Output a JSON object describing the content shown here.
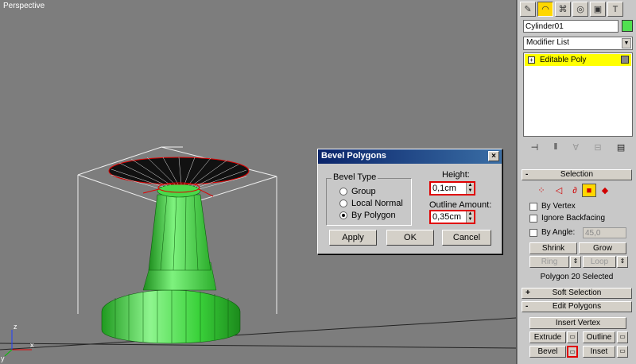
{
  "viewport": {
    "label": "Perspective"
  },
  "dialog": {
    "title": "Bevel Polygons",
    "close_glyph": "×",
    "bevel_type": {
      "legend": "Bevel Type",
      "options": [
        "Group",
        "Local Normal",
        "By Polygon"
      ],
      "selected": "By Polygon"
    },
    "height": {
      "label": "Height:",
      "value": "0,1cm"
    },
    "outline": {
      "label": "Outline Amount:",
      "value": "0,35cm"
    },
    "buttons": {
      "apply": "Apply",
      "ok": "OK",
      "cancel": "Cancel"
    }
  },
  "panel": {
    "tabs": [
      "create-tab",
      "modify-tab",
      "hierarchy-tab",
      "motion-tab",
      "display-tab",
      "utilities-tab"
    ],
    "tab_glyphs": [
      "✎",
      "◠",
      "⌘",
      "◎",
      "▣",
      "T"
    ],
    "active_tab": "modify-tab",
    "object_name": "Cylinder01",
    "object_color": "#50e050",
    "modifier_list": "Modifier List",
    "stack_item": "Editable Poly",
    "stack_tool_glyphs": [
      "⊣",
      "‖",
      "∀",
      "⊟",
      "▤"
    ]
  },
  "selection": {
    "header": "Selection",
    "sign": "-",
    "level_glyphs": [
      "⁘",
      "◁",
      "∂",
      "■",
      "◆"
    ],
    "by_vertex": "By Vertex",
    "ignore_backfacing": "Ignore Backfacing",
    "by_angle": "By Angle:",
    "angle_value": "45,0",
    "shrink": "Shrink",
    "grow": "Grow",
    "ring": "Ring",
    "loop": "Loop",
    "status": "Polygon 20 Selected"
  },
  "soft_selection": {
    "header": "Soft Selection",
    "sign": "+"
  },
  "edit_polygons": {
    "header": "Edit Polygons",
    "sign": "-",
    "insert_vertex": "Insert Vertex",
    "extrude": "Extrude",
    "outline": "Outline",
    "bevel": "Bevel",
    "inset": "Inset"
  },
  "colors": {
    "accent_yellow": "#ffff00",
    "highlight_red": "#e00000",
    "mesh_green": "#3fe03f"
  }
}
